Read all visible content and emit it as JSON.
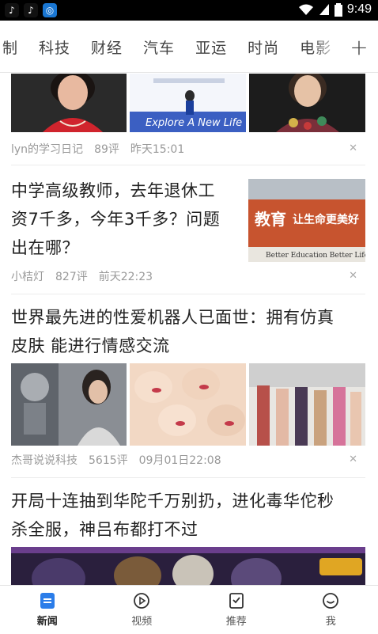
{
  "status_bar": {
    "time": "9:49",
    "app_icons": [
      "tiktok-icon",
      "tiktok-icon",
      "browser-icon"
    ]
  },
  "channels": {
    "tabs": [
      "制",
      "科技",
      "财经",
      "汽车",
      "亚运",
      "时尚",
      "电影"
    ],
    "add_label": "+"
  },
  "feed": {
    "items": [
      {
        "source": "lyn的学习日记",
        "comments": "89评",
        "time": "昨天15:01",
        "images": [
          "woman-portrait",
          "conference-stage",
          "woman-portrait"
        ],
        "image_text": "Explore A New Life"
      },
      {
        "title": "中学高级教师，去年退休工资7千多，今年3千多？问题出在哪？",
        "title_lines": [
          "中学高级教师，去年退休工",
          "资7千多，今年3千多？问题",
          "出在哪？"
        ],
        "source": "小桔灯",
        "comments": "827评",
        "time": "前天22:23",
        "image_text_cn": [
          "教育",
          "让生命更美好"
        ],
        "image_text_en": "Better Education Better Life"
      },
      {
        "title": "世界最先进的性爱机器人已面世：拥有仿真皮肤 能进行情感交流",
        "title_lines": [
          "世界最先进的性爱机器人已面世：拥有仿真",
          "皮肤 能进行情感交流"
        ],
        "source": "杰哥说说科技",
        "comments": "5615评",
        "time": "09月01日22:08",
        "images": [
          "robot-woman",
          "doll-faces",
          "doll-display"
        ]
      },
      {
        "title": "开局十连抽到华陀千万别扔，进化毒华佗秒杀全服，神吕布都打不过",
        "title_lines": [
          "开局十连抽到华陀千万别扔，进化毒华佗秒",
          "杀全服，神吕布都打不过"
        ],
        "image": "game-banner"
      }
    ]
  },
  "bottom_nav": {
    "items": [
      {
        "label": "新闻",
        "icon": "news-icon",
        "active": true
      },
      {
        "label": "视频",
        "icon": "video-play-icon",
        "active": false
      },
      {
        "label": "推荐",
        "icon": "recommend-icon",
        "active": false
      },
      {
        "label": "我",
        "icon": "smile-face-icon",
        "active": false
      }
    ]
  },
  "colors": {
    "accent": "#2b7de9",
    "text": "#222222",
    "meta": "#999999"
  }
}
